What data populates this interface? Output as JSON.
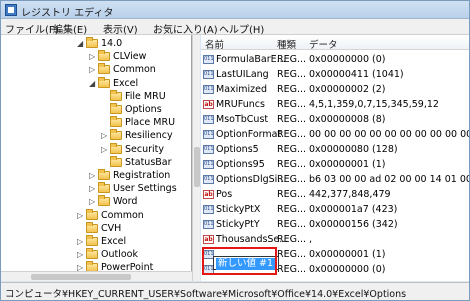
{
  "window": {
    "title": "レジストリ エディタ"
  },
  "menu": [
    "ファイル(F)",
    "編集(E)",
    "表示(V)",
    "お気に入り(A)",
    "ヘルプ(H)"
  ],
  "tree": [
    {
      "label": "14.0",
      "twisty": "◢"
    },
    {
      "label": "CLView",
      "twisty": "▷"
    },
    {
      "label": "Common",
      "twisty": "▷"
    },
    {
      "label": "Excel",
      "twisty": "◢"
    },
    {
      "label": "File MRU",
      "twisty": ""
    },
    {
      "label": "Options",
      "twisty": ""
    },
    {
      "label": "Place MRU",
      "twisty": ""
    },
    {
      "label": "Resiliency",
      "twisty": "▷"
    },
    {
      "label": "Security",
      "twisty": "▷"
    },
    {
      "label": "StatusBar",
      "twisty": ""
    },
    {
      "label": "Registration",
      "twisty": "▷"
    },
    {
      "label": "User Settings",
      "twisty": "▷"
    },
    {
      "label": "Word",
      "twisty": "▷"
    },
    {
      "label": "Common",
      "twisty": "▷"
    },
    {
      "label": "CVH",
      "twisty": ""
    },
    {
      "label": "Excel",
      "twisty": "▷"
    },
    {
      "label": "Outlook",
      "twisty": "▷"
    },
    {
      "label": "PowerPoint",
      "twisty": "▷"
    }
  ],
  "columns": {
    "name": "名前",
    "type": "種類",
    "data": "データ"
  },
  "values": [
    {
      "name": "FormulaBarE...",
      "type": "REG...",
      "data": "0x00000000 (0)",
      "icon": "dword"
    },
    {
      "name": "LastUILang",
      "type": "REG...",
      "data": "0x00000411 (1041)",
      "icon": "dword"
    },
    {
      "name": "Maximized",
      "type": "REG...",
      "data": "0x00000002 (2)",
      "icon": "dword"
    },
    {
      "name": "MRUFuncs",
      "type": "REG...",
      "data": "4,5,1,359,0,7,15,345,59,12",
      "icon": "string"
    },
    {
      "name": "MsoTbCust",
      "type": "REG...",
      "data": "0x00000008 (8)",
      "icon": "dword"
    },
    {
      "name": "OptionFormat",
      "type": "REG...",
      "data": "00 00 00 00 00 00 00 00 00 00 00",
      "icon": "dword"
    },
    {
      "name": "Options5",
      "type": "REG...",
      "data": "0x00000080 (128)",
      "icon": "dword"
    },
    {
      "name": "Options95",
      "type": "REG...",
      "data": "0x00000001 (1)",
      "icon": "dword"
    },
    {
      "name": "OptionsDlgSi...",
      "type": "REG...",
      "data": "b6 03 00 00 ad 02 00 00 14 01 00 00",
      "icon": "dword"
    },
    {
      "name": "Pos",
      "type": "REG...",
      "data": "442,377,848,479",
      "icon": "string"
    },
    {
      "name": "StickyPtX",
      "type": "REG...",
      "data": "0x000001a7 (423)",
      "icon": "dword"
    },
    {
      "name": "StickyPtY",
      "type": "REG...",
      "data": "0x00000156 (342)",
      "icon": "dword"
    },
    {
      "name": "ThousandsSe...",
      "type": "REG...",
      "data": ",",
      "icon": "string"
    },
    {
      "name": "",
      "type": "REG...",
      "data": "0x00000001 (1)",
      "icon": "dword"
    },
    {
      "name": "",
      "type": "REG...",
      "data": "0x00000000 (0)",
      "icon": "dword"
    }
  ],
  "edit": {
    "text": "新しい値 #1"
  },
  "status": "コンピュータ¥HKEY_CURRENT_USER¥Software¥Microsoft¥Office¥14.0¥Excel¥Options",
  "colors": {
    "highlight": "#e51616",
    "selection": "#3399ff"
  }
}
